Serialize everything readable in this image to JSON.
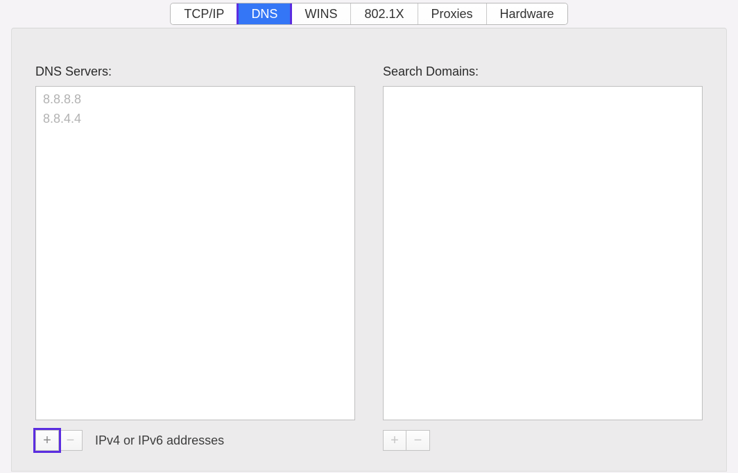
{
  "tabs": {
    "tcpip": {
      "label": "TCP/IP",
      "selected": false
    },
    "dns": {
      "label": "DNS",
      "selected": true
    },
    "wins": {
      "label": "WINS",
      "selected": false
    },
    "dot1x": {
      "label": "802.1X",
      "selected": false
    },
    "proxies": {
      "label": "Proxies",
      "selected": false
    },
    "hardware": {
      "label": "Hardware",
      "selected": false
    }
  },
  "dns_panel": {
    "servers_label": "DNS Servers:",
    "servers": [
      "8.8.8.8",
      "8.8.4.4"
    ],
    "hint": "IPv4 or IPv6 addresses",
    "add_glyph": "+",
    "remove_glyph": "−"
  },
  "search_panel": {
    "label": "Search Domains:",
    "domains": [],
    "add_glyph": "+",
    "remove_glyph": "−"
  }
}
